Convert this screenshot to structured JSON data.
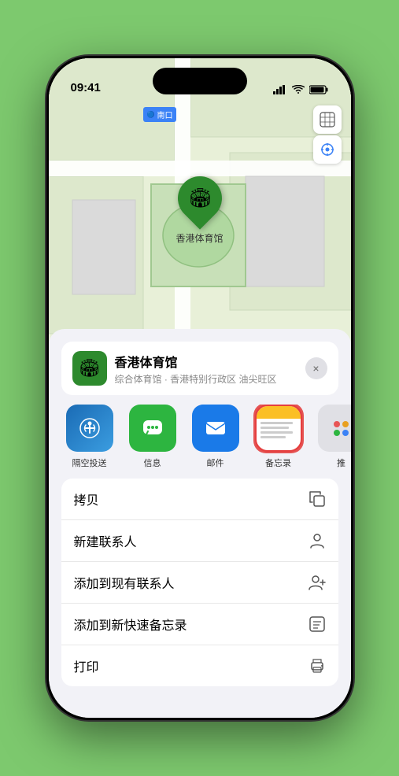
{
  "phone": {
    "status_bar": {
      "time": "09:41",
      "battery": "▮▮▮▮",
      "signal": "▮▮▮▮",
      "wifi": "wifi"
    }
  },
  "map": {
    "label_text": "南口",
    "pin_label": "香港体育馆",
    "map_label": "南口"
  },
  "location_card": {
    "name": "香港体育馆",
    "description": "综合体育馆 · 香港特别行政区 油尖旺区",
    "close_label": "×"
  },
  "share_items": [
    {
      "id": "airdrop",
      "label": "隔空投送",
      "class": "share-icon-airdrop"
    },
    {
      "id": "message",
      "label": "信息",
      "class": "share-icon-message"
    },
    {
      "id": "mail",
      "label": "邮件",
      "class": "share-icon-mail"
    },
    {
      "id": "notes",
      "label": "备忘录",
      "class": "share-icon-notes"
    },
    {
      "id": "more",
      "label": "推",
      "class": "share-icon-more"
    }
  ],
  "actions": [
    {
      "id": "copy",
      "label": "拷贝",
      "icon": "copy"
    },
    {
      "id": "new-contact",
      "label": "新建联系人",
      "icon": "person"
    },
    {
      "id": "add-existing",
      "label": "添加到现有联系人",
      "icon": "person-add"
    },
    {
      "id": "add-quick-note",
      "label": "添加到新快速备忘录",
      "icon": "note"
    },
    {
      "id": "print",
      "label": "打印",
      "icon": "print"
    }
  ],
  "icons": {
    "airdrop_char": "📡",
    "message_char": "💬",
    "mail_char": "✉",
    "more_char": "···",
    "copy_char": "⧉",
    "person_char": "⊙",
    "person_add_char": "⊕",
    "note_char": "▣",
    "print_char": "⬜",
    "map_type_char": "🗺",
    "location_char": "◎"
  }
}
